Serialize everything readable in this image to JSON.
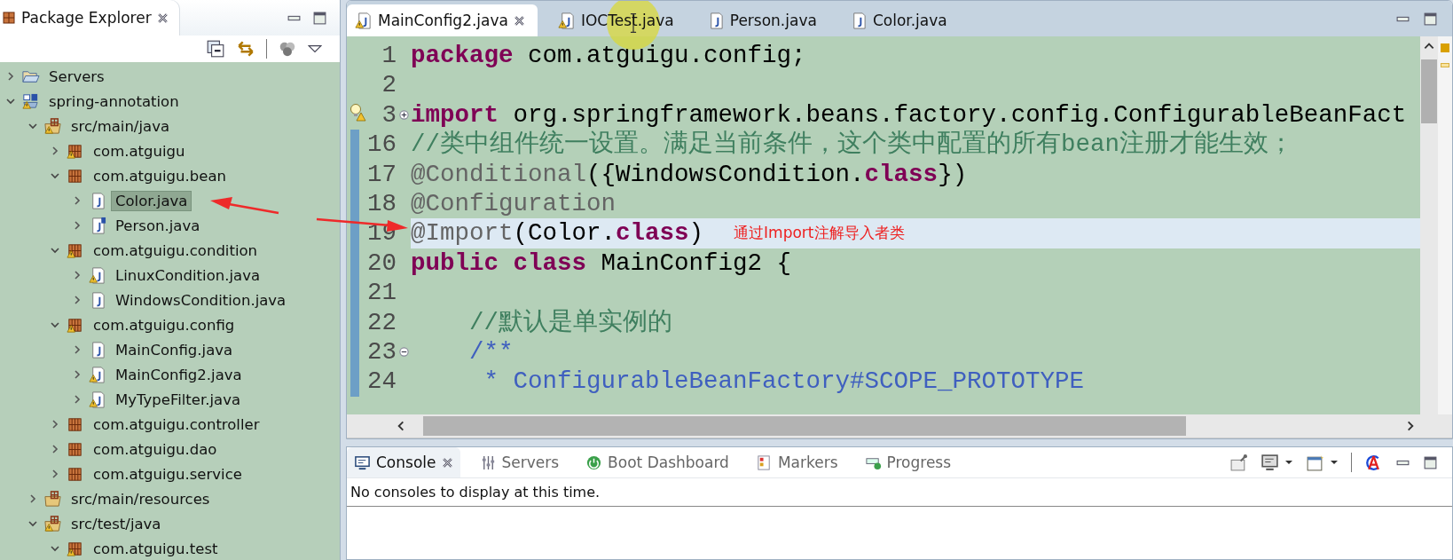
{
  "package_explorer": {
    "title": "Package Explorer",
    "tree": [
      {
        "label": "Servers",
        "kind": "folder",
        "expanded": false,
        "selected": false,
        "warning": false
      },
      {
        "label": "spring-annotation",
        "kind": "project",
        "expanded": true,
        "selected": false,
        "warning": true,
        "children": [
          {
            "label": "src/main/java",
            "kind": "source-folder",
            "expanded": true,
            "selected": false,
            "warning": true,
            "children": [
              {
                "label": "com.atguigu",
                "kind": "package",
                "expanded": false,
                "selected": false,
                "warning": true
              },
              {
                "label": "com.atguigu.bean",
                "kind": "package",
                "expanded": true,
                "selected": false,
                "warning": false,
                "children": [
                  {
                    "label": "Color.java",
                    "kind": "java-file",
                    "expanded": false,
                    "selected": true,
                    "warning": false
                  },
                  {
                    "label": "Person.java",
                    "kind": "spring-java-file",
                    "expanded": false,
                    "selected": false,
                    "warning": false
                  }
                ]
              },
              {
                "label": "com.atguigu.condition",
                "kind": "package",
                "expanded": true,
                "selected": false,
                "warning": true,
                "children": [
                  {
                    "label": "LinuxCondition.java",
                    "kind": "java-file",
                    "expanded": false,
                    "selected": false,
                    "warning": true
                  },
                  {
                    "label": "WindowsCondition.java",
                    "kind": "java-file",
                    "expanded": false,
                    "selected": false,
                    "warning": false
                  }
                ]
              },
              {
                "label": "com.atguigu.config",
                "kind": "package",
                "expanded": true,
                "selected": false,
                "warning": true,
                "children": [
                  {
                    "label": "MainConfig.java",
                    "kind": "java-file",
                    "expanded": false,
                    "selected": false,
                    "warning": false
                  },
                  {
                    "label": "MainConfig2.java",
                    "kind": "java-file",
                    "expanded": false,
                    "selected": false,
                    "warning": true
                  },
                  {
                    "label": "MyTypeFilter.java",
                    "kind": "java-file",
                    "expanded": false,
                    "selected": false,
                    "warning": true
                  }
                ]
              },
              {
                "label": "com.atguigu.controller",
                "kind": "package",
                "expanded": false,
                "selected": false,
                "warning": false
              },
              {
                "label": "com.atguigu.dao",
                "kind": "package",
                "expanded": false,
                "selected": false,
                "warning": false
              },
              {
                "label": "com.atguigu.service",
                "kind": "package",
                "expanded": false,
                "selected": false,
                "warning": false
              }
            ]
          },
          {
            "label": "src/main/resources",
            "kind": "source-folder",
            "expanded": false,
            "selected": false,
            "warning": false
          },
          {
            "label": "src/test/java",
            "kind": "source-folder",
            "expanded": true,
            "selected": false,
            "warning": true,
            "children": [
              {
                "label": "com.atguigu.test",
                "kind": "package",
                "expanded": true,
                "selected": false,
                "warning": true
              }
            ]
          }
        ]
      }
    ]
  },
  "editor": {
    "tabs": [
      {
        "label": "MainConfig2.java",
        "selected": true,
        "warning": true
      },
      {
        "label": "IOCTest.java",
        "selected": false,
        "warning": true
      },
      {
        "label": "Person.java",
        "selected": false,
        "warning": false
      },
      {
        "label": "Color.java",
        "selected": false,
        "warning": false
      }
    ],
    "lines": [
      {
        "number": "1",
        "highlighted": false,
        "changed": false,
        "warning": false,
        "segments": [
          {
            "kind": "keyword",
            "text": "package"
          },
          {
            "kind": "plain",
            "text": " com.atguigu.config;"
          }
        ]
      },
      {
        "number": "2",
        "highlighted": false,
        "changed": false,
        "warning": false
      },
      {
        "number": "3",
        "highlighted": false,
        "changed": false,
        "warning": true,
        "folded": true,
        "segments": [
          {
            "kind": "keyword",
            "text": "import"
          },
          {
            "kind": "plain",
            "text": " org.springframework.beans.factory.config.ConfigurableBeanFact"
          }
        ]
      },
      {
        "number": "16",
        "highlighted": false,
        "changed": true,
        "warning": false,
        "segments": [
          {
            "kind": "comment",
            "text": "//类中组件统一设置。满足当前条件，这个类中配置的所有bean注册才能生效；"
          }
        ]
      },
      {
        "number": "17",
        "highlighted": false,
        "changed": true,
        "warning": false,
        "segments": [
          {
            "kind": "annotation",
            "text": "@Conditional"
          },
          {
            "kind": "plain",
            "text": "({WindowsCondition."
          },
          {
            "kind": "keyword",
            "text": "class"
          },
          {
            "kind": "plain",
            "text": "})"
          }
        ]
      },
      {
        "number": "18",
        "highlighted": false,
        "changed": true,
        "warning": false,
        "segments": [
          {
            "kind": "annotation",
            "text": "@Configuration"
          }
        ]
      },
      {
        "number": "19",
        "highlighted": true,
        "changed": true,
        "warning": false,
        "segments": [
          {
            "kind": "annotation",
            "text": "@Import"
          },
          {
            "kind": "plain",
            "text": "(Color."
          },
          {
            "kind": "keyword",
            "text": "class"
          },
          {
            "kind": "plain",
            "text": ")"
          }
        ],
        "note": "通过Import注解导入者类"
      },
      {
        "number": "20",
        "highlighted": false,
        "changed": true,
        "warning": false,
        "segments": [
          {
            "kind": "keyword",
            "text": "public class"
          },
          {
            "kind": "plain",
            "text": " MainConfig2 {"
          }
        ]
      },
      {
        "number": "21",
        "highlighted": false,
        "changed": true,
        "warning": false
      },
      {
        "number": "22",
        "highlighted": false,
        "changed": true,
        "warning": false,
        "segments": [
          {
            "kind": "comment",
            "text": "    //默认是单实例的"
          }
        ]
      },
      {
        "number": "23",
        "highlighted": false,
        "changed": true,
        "warning": false,
        "folded": false,
        "segments": [
          {
            "kind": "javadoc",
            "text": "    /**"
          }
        ]
      },
      {
        "number": "24",
        "highlighted": false,
        "changed": true,
        "warning": false,
        "segments": [
          {
            "kind": "javadoc",
            "text": "     * ConfigurableBeanFactory#SCOPE_PROTOTYPE"
          }
        ]
      }
    ]
  },
  "console": {
    "tabs": [
      {
        "label": "Console",
        "selected": true
      },
      {
        "label": "Servers",
        "selected": false
      },
      {
        "label": "Boot Dashboard",
        "selected": false
      },
      {
        "label": "Markers",
        "selected": false
      },
      {
        "label": "Progress",
        "selected": false
      }
    ],
    "message": "No consoles to display at this time."
  }
}
